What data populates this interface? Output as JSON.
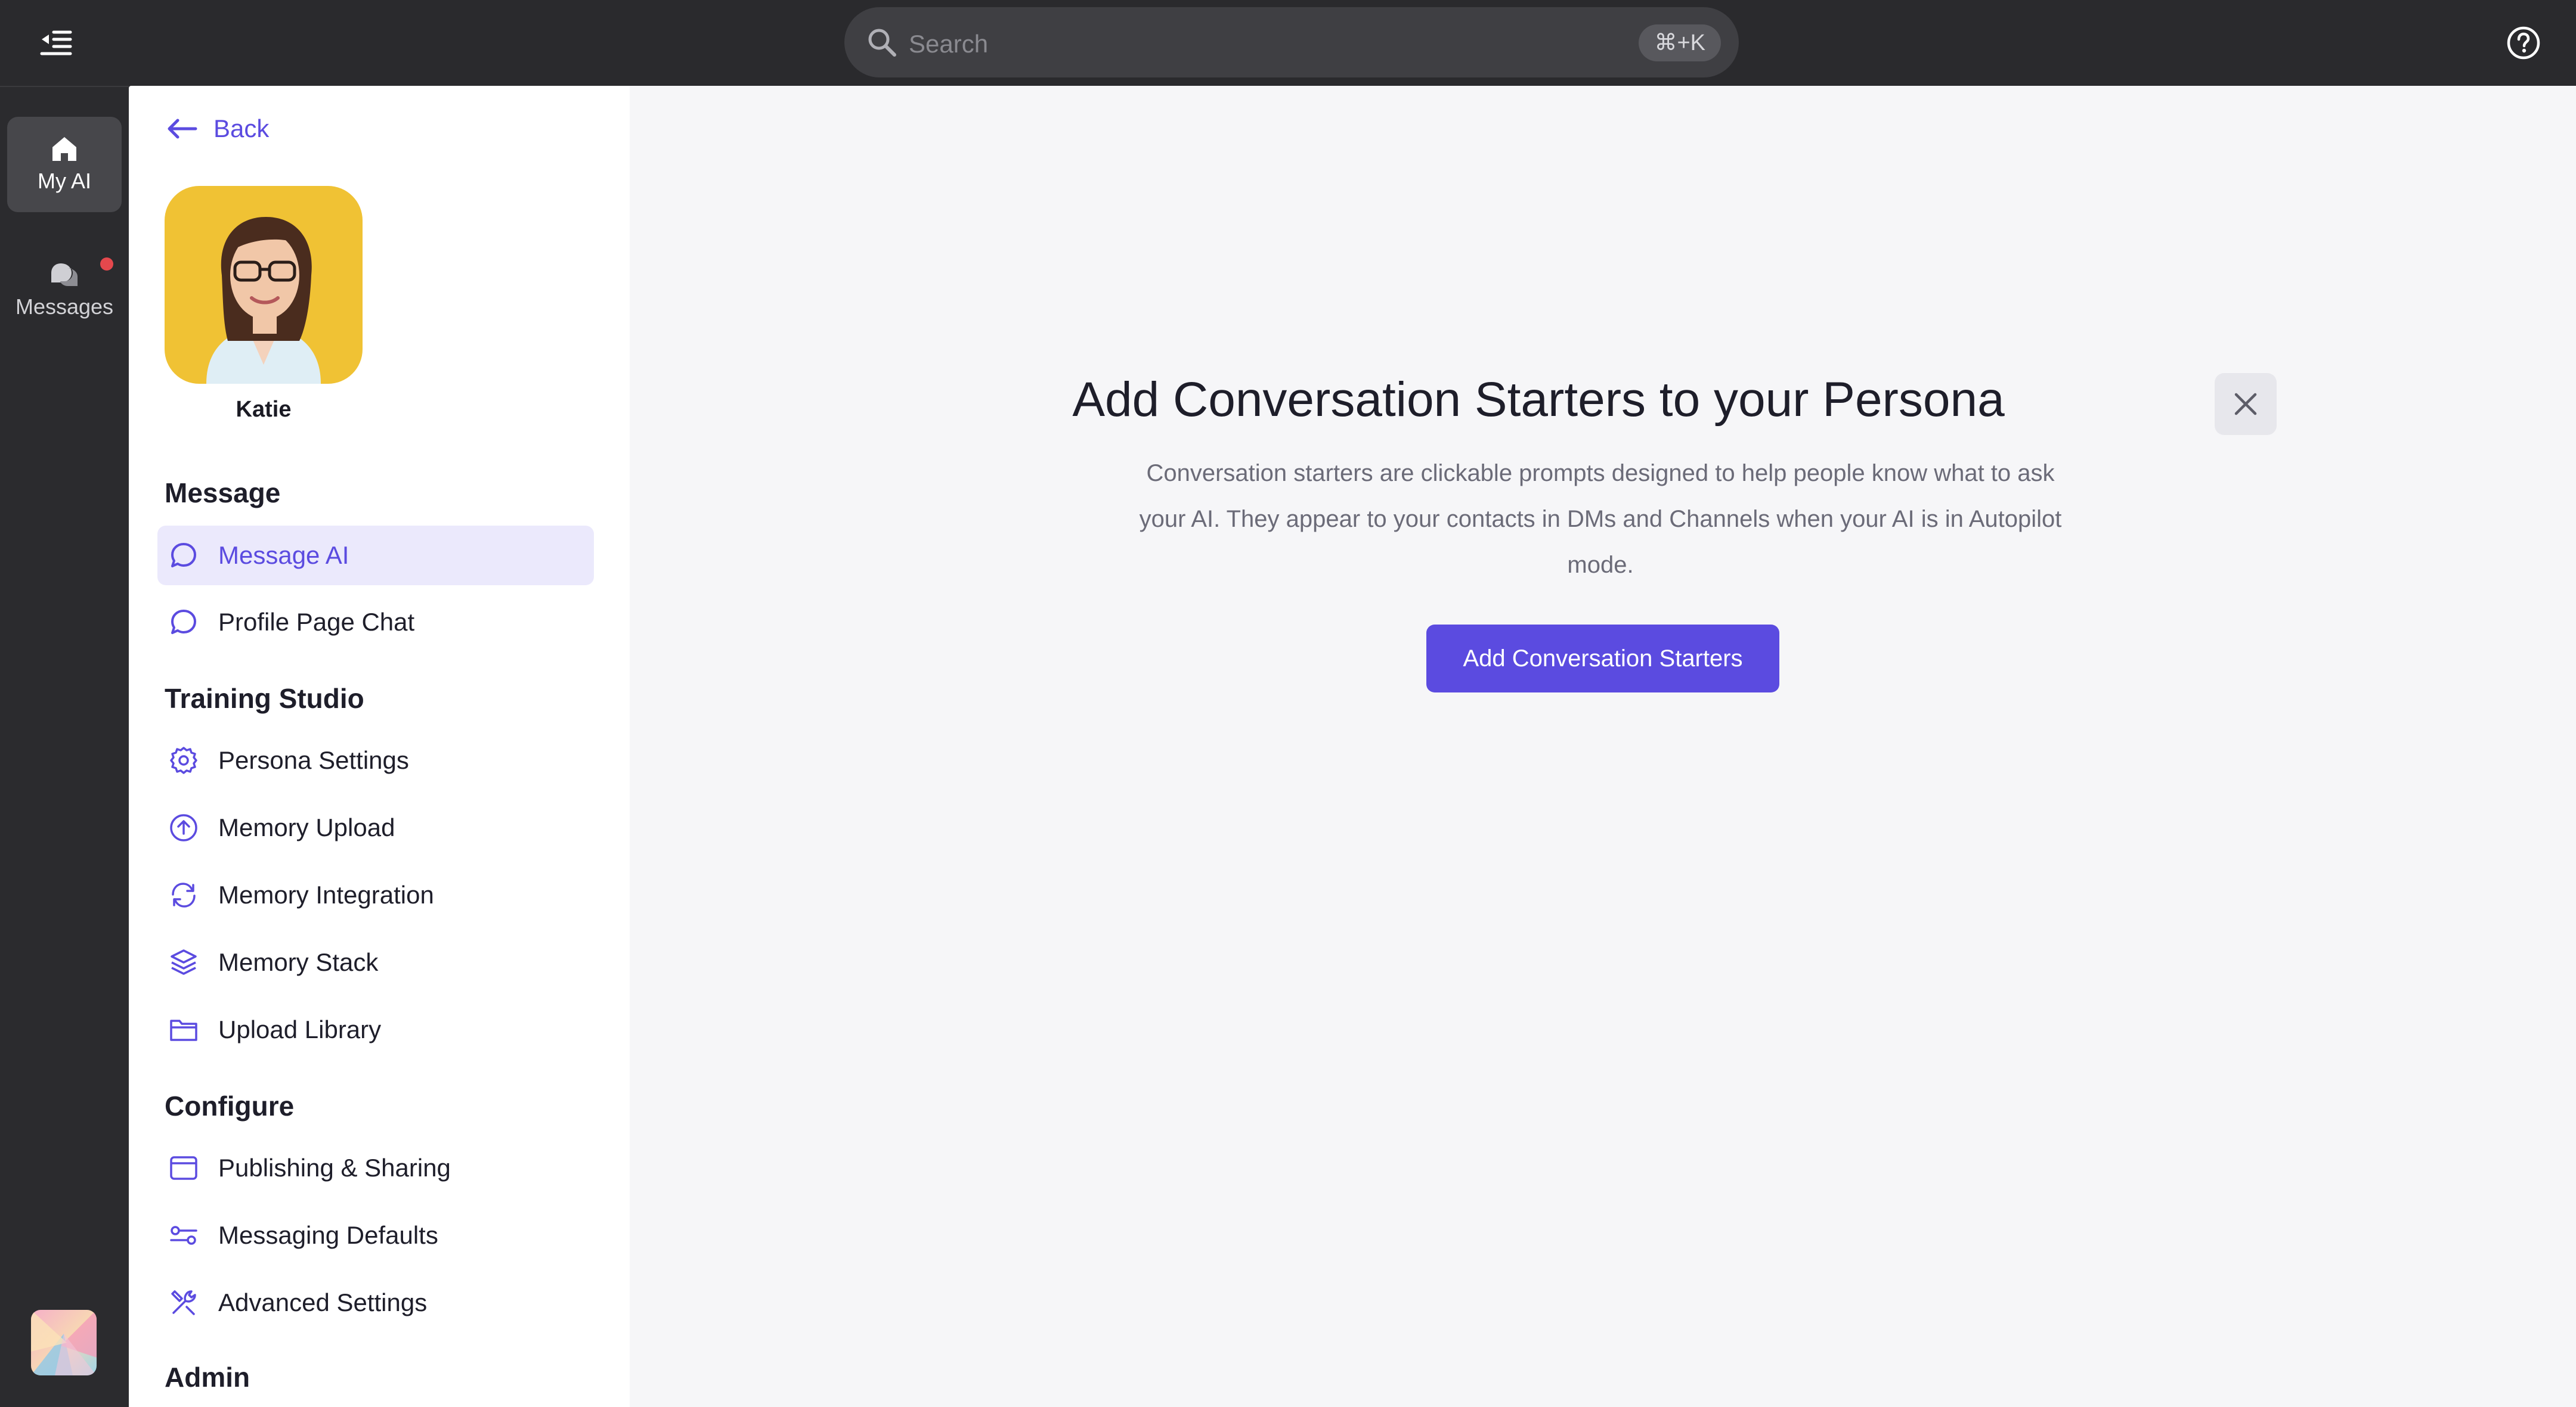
{
  "topbar": {
    "search_placeholder": "Search",
    "search_shortcut": "⌘+K",
    "icons": [
      "collapse-sidebar-icon",
      "search-icon",
      "help-icon"
    ]
  },
  "rail": {
    "items": [
      {
        "label": "My AI",
        "icon": "home-icon",
        "active": true
      },
      {
        "label": "Messages",
        "icon": "messages-icon",
        "has_notification": true
      }
    ]
  },
  "sidebar": {
    "back_label": "Back",
    "persona_name": "Katie",
    "sections": [
      {
        "title": "Message",
        "items": [
          {
            "label": "Message AI",
            "icon": "chat-bubble-icon",
            "active": true
          },
          {
            "label": "Profile Page Chat",
            "icon": "chat-bubble-icon"
          }
        ]
      },
      {
        "title": "Training Studio",
        "items": [
          {
            "label": "Persona Settings",
            "icon": "gear-icon"
          },
          {
            "label": "Memory Upload",
            "icon": "upload-circle-icon"
          },
          {
            "label": "Memory Integration",
            "icon": "sync-icon"
          },
          {
            "label": "Memory Stack",
            "icon": "layers-icon"
          },
          {
            "label": "Upload Library",
            "icon": "folder-icon"
          }
        ]
      },
      {
        "title": "Configure",
        "items": [
          {
            "label": "Publishing & Sharing",
            "icon": "browser-window-icon"
          },
          {
            "label": "Messaging Defaults",
            "icon": "sliders-icon"
          },
          {
            "label": "Advanced Settings",
            "icon": "tools-icon"
          }
        ]
      },
      {
        "title": "Admin",
        "items": []
      }
    ]
  },
  "main": {
    "title": "Add Conversation Starters to your Persona",
    "description": "Conversation starters are clickable prompts designed to help people know what to ask your AI. They appear to your contacts in DMs and Channels when your AI is in Autopilot mode.",
    "cta_label": "Add Conversation Starters"
  },
  "colors": {
    "accent": "#5b4be0",
    "accent_light": "#ebe9fc",
    "topbar_bg": "#2a2a2d",
    "main_bg": "#f6f6f8",
    "notification": "#e5484d"
  }
}
